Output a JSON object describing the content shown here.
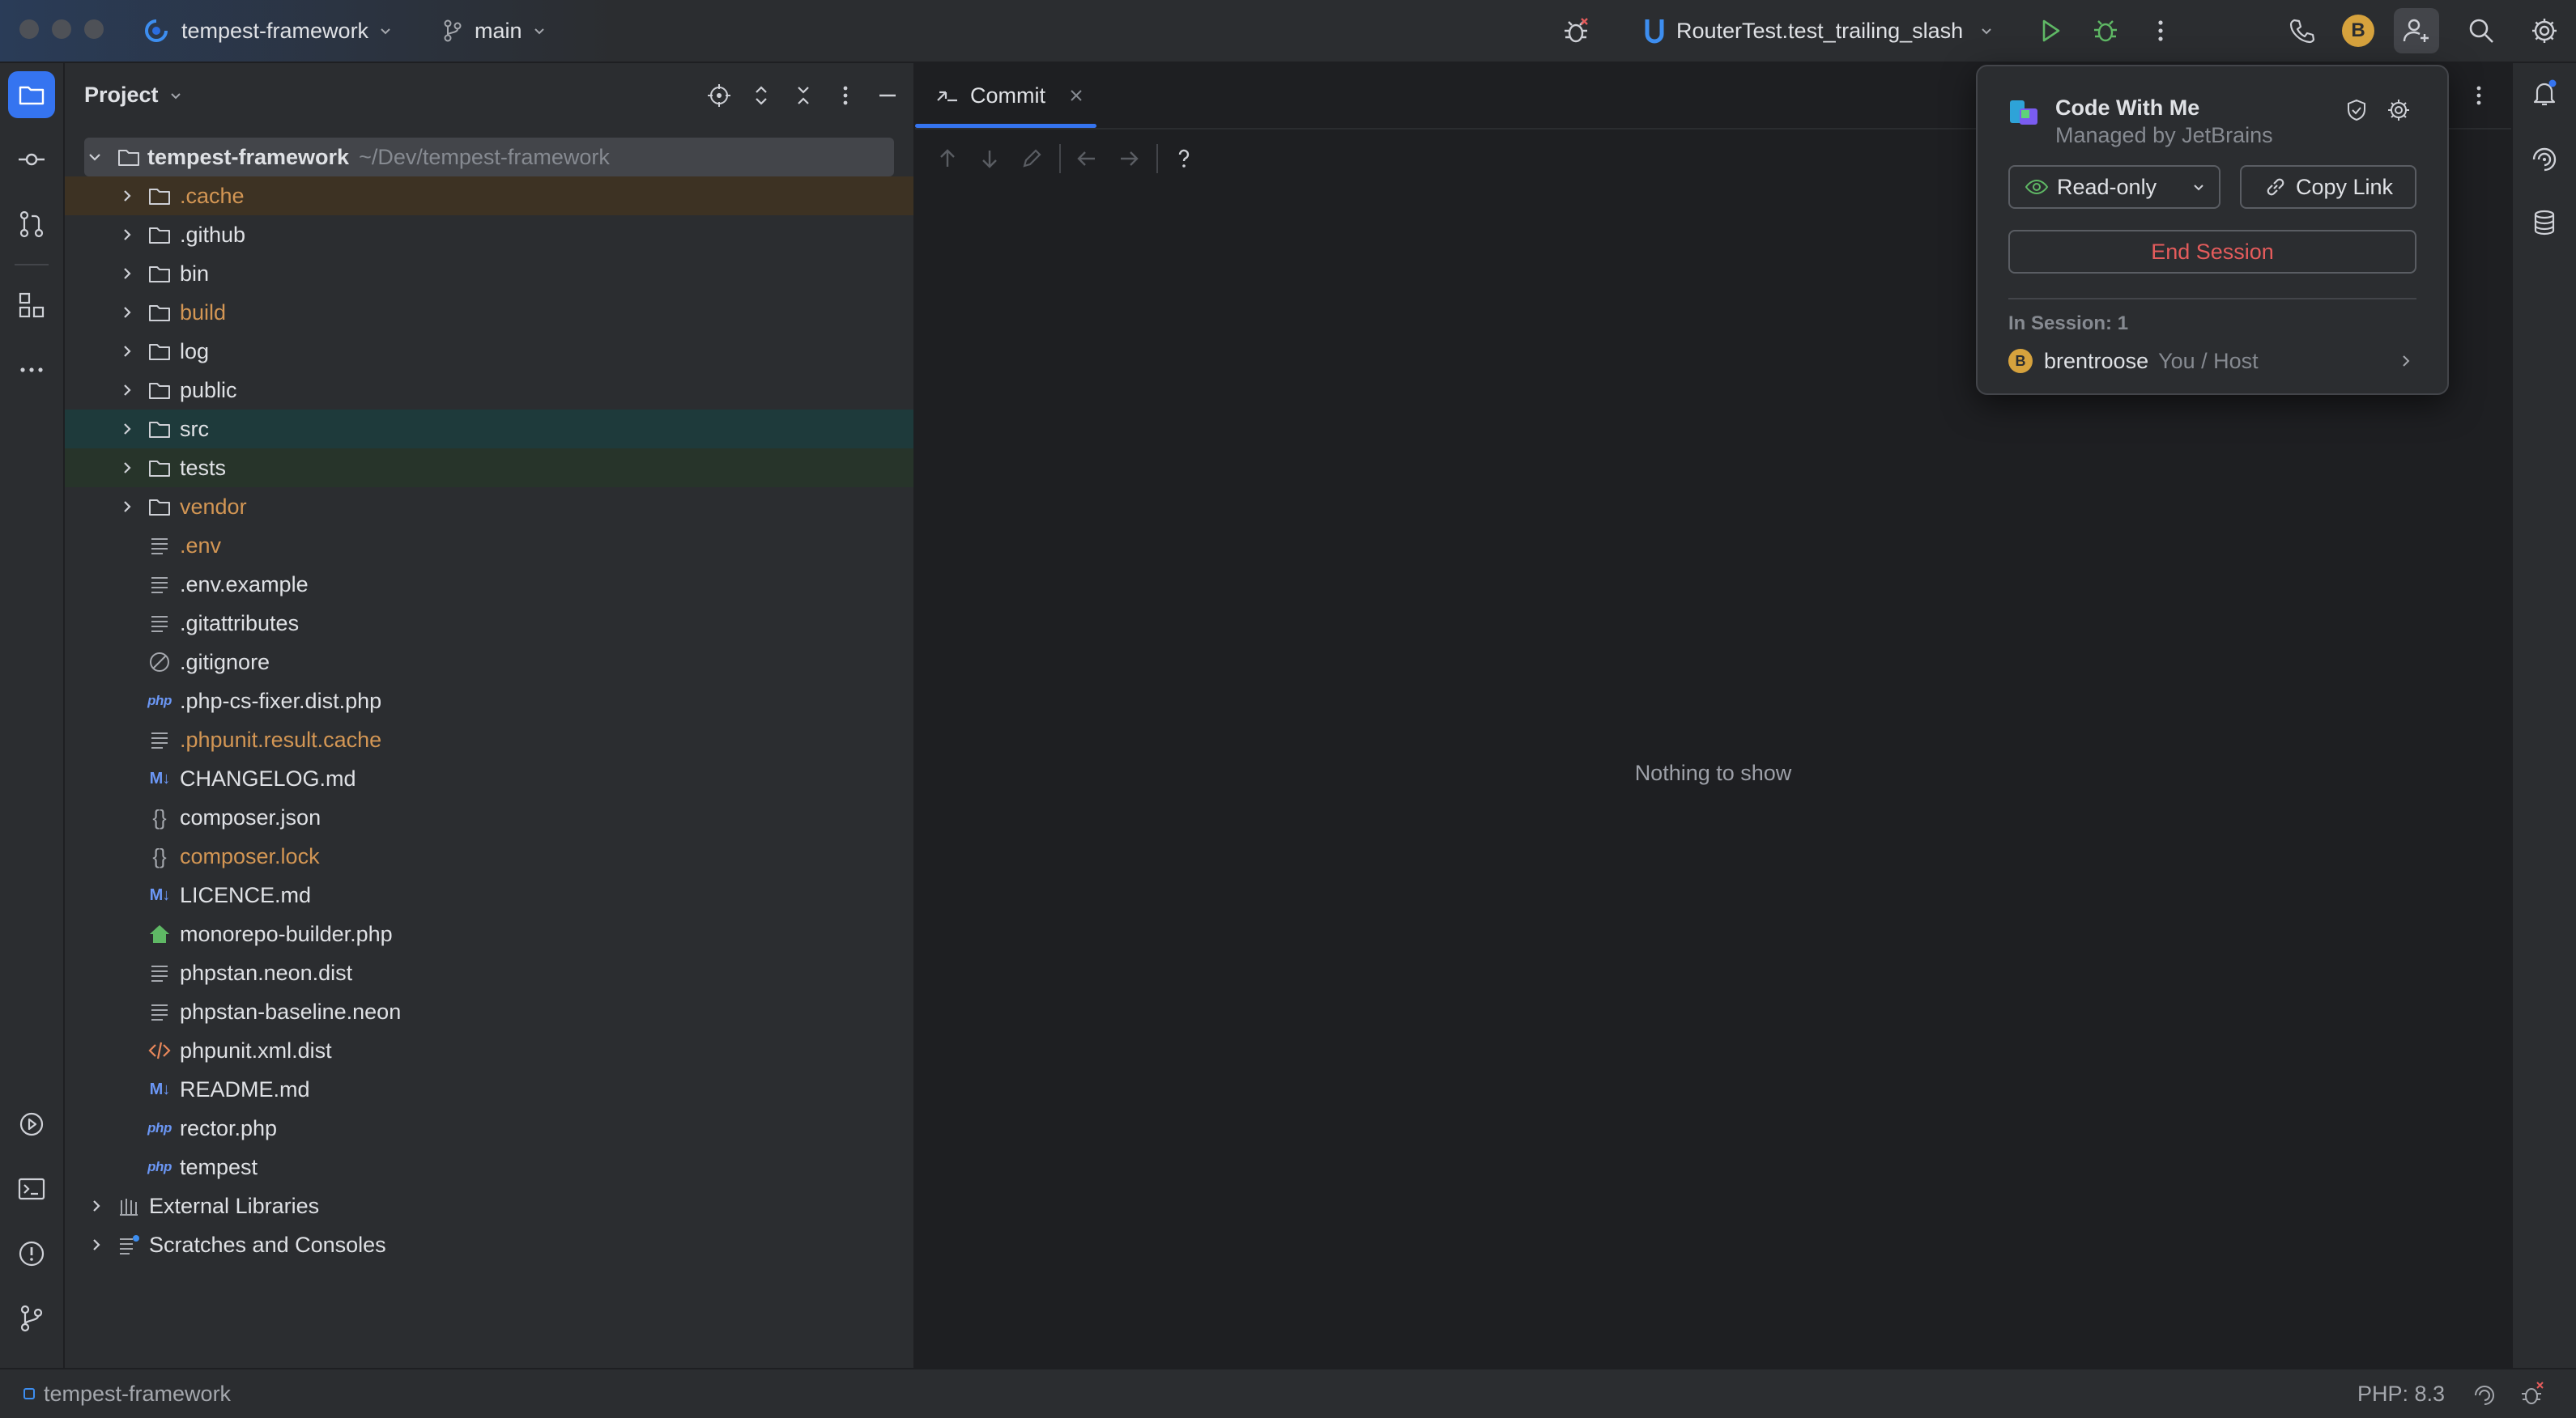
{
  "titlebar": {
    "project": "tempest-framework",
    "branch": "main",
    "run_config": "RouterTest.test_trailing_slash",
    "avatar_initial": "B"
  },
  "project_panel": {
    "title": "Project",
    "root": {
      "name": "tempest-framework",
      "path": "~/Dev/tempest-framework"
    },
    "items": [
      {
        "name": ".cache",
        "type": "folder",
        "color": "#d39654",
        "highlight": "orange"
      },
      {
        "name": ".github",
        "type": "folder"
      },
      {
        "name": "bin",
        "type": "folder"
      },
      {
        "name": "build",
        "type": "folder",
        "color": "#d39654"
      },
      {
        "name": "log",
        "type": "folder"
      },
      {
        "name": "public",
        "type": "folder"
      },
      {
        "name": "src",
        "type": "folder",
        "highlight": "teal"
      },
      {
        "name": "tests",
        "type": "folder",
        "highlight": "green"
      },
      {
        "name": "vendor",
        "type": "folder",
        "color": "#d39654"
      },
      {
        "name": ".env",
        "type": "text",
        "color": "#d39654"
      },
      {
        "name": ".env.example",
        "type": "text"
      },
      {
        "name": ".gitattributes",
        "type": "text"
      },
      {
        "name": ".gitignore",
        "type": "ignore"
      },
      {
        "name": ".php-cs-fixer.dist.php",
        "type": "php"
      },
      {
        "name": ".phpunit.result.cache",
        "type": "text",
        "color": "#d39654"
      },
      {
        "name": "CHANGELOG.md",
        "type": "md"
      },
      {
        "name": "composer.json",
        "type": "json"
      },
      {
        "name": "composer.lock",
        "type": "json",
        "color": "#d39654"
      },
      {
        "name": "LICENCE.md",
        "type": "md"
      },
      {
        "name": "monorepo-builder.php",
        "type": "house"
      },
      {
        "name": "phpstan.neon.dist",
        "type": "text"
      },
      {
        "name": "phpstan-baseline.neon",
        "type": "text"
      },
      {
        "name": "phpunit.xml.dist",
        "type": "xml"
      },
      {
        "name": "README.md",
        "type": "md"
      },
      {
        "name": "rector.php",
        "type": "php"
      },
      {
        "name": "tempest",
        "type": "php"
      }
    ],
    "external_libraries": "External Libraries",
    "scratches": "Scratches and Consoles"
  },
  "editor": {
    "tab_label": "Commit",
    "empty_text": "Nothing to show"
  },
  "popup": {
    "title": "Code With Me",
    "subtitle": "Managed by JetBrains",
    "readonly_label": "Read-only",
    "copy_link_label": "Copy Link",
    "end_session_label": "End Session",
    "in_session_label": "In Session: 1",
    "user_name": "brentroose",
    "user_role": "You / Host",
    "user_initial": "B"
  },
  "statusbar": {
    "project": "tempest-framework",
    "php_version": "PHP: 8.3"
  },
  "colors": {
    "accent": "#3574f0",
    "danger": "#e55c5c",
    "ignored": "#d39654"
  }
}
